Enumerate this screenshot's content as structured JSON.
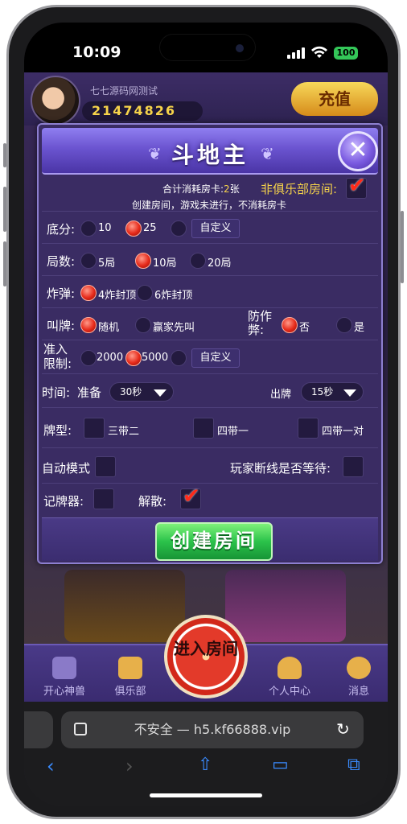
{
  "status": {
    "time": "10:09",
    "battery": "100"
  },
  "game": {
    "nickname": "七七源码网测试",
    "coins": "21474826",
    "recharge_label": "充值"
  },
  "dialog": {
    "title": "斗地主",
    "cost_label": "合计消耗房卡:",
    "cost_value": "2",
    "cost_unit": "张",
    "non_club_label": "非俱乐部房间:",
    "notice": "创建房间，游戏未进行，不消耗房卡",
    "base_score": {
      "label": "底分:",
      "options": [
        "10",
        "25"
      ],
      "custom": "自定义",
      "selected": "25"
    },
    "rounds": {
      "label": "局数:",
      "options": [
        "5局",
        "10局",
        "20局"
      ],
      "selected": "10局"
    },
    "bomb": {
      "label": "炸弹:",
      "options": [
        "4炸封顶",
        "6炸封顶"
      ],
      "selected": "4炸封顶"
    },
    "call": {
      "label": "叫牌:",
      "options": [
        "随机",
        "赢家先叫"
      ],
      "selected": "随机"
    },
    "anti_cheat": {
      "label": "防作弊:",
      "options": [
        "否",
        "是"
      ],
      "selected": "否"
    },
    "entry": {
      "label": "准入限制:",
      "options": [
        "2000",
        "5000"
      ],
      "custom": "自定义",
      "selected": "5000"
    },
    "time": {
      "label": "时间:",
      "ready_label": "准备",
      "ready_value": "30秒",
      "play_label": "出牌",
      "play_value": "15秒"
    },
    "card_types": {
      "label": "牌型:",
      "options": [
        "三带二",
        "四带一",
        "四带一对"
      ]
    },
    "auto_mode": "自动模式",
    "wait_disconnect": "玩家断线是否等待:",
    "card_counter": "记牌器:",
    "dissolve": "解散:",
    "create_button": "创建房间"
  },
  "bottom_nav": {
    "items": [
      "开心神兽",
      "俱乐部",
      "个人中心",
      "消息"
    ],
    "enter_room": "进入房间"
  },
  "browser": {
    "url_text": "不安全 — h5.kf66888.vip"
  },
  "colors": {
    "accent_red": "#e62a1a",
    "create_green": "#2bc24a",
    "dialog_purple": "#3a2c63",
    "header_purple": "#6b54d0"
  }
}
